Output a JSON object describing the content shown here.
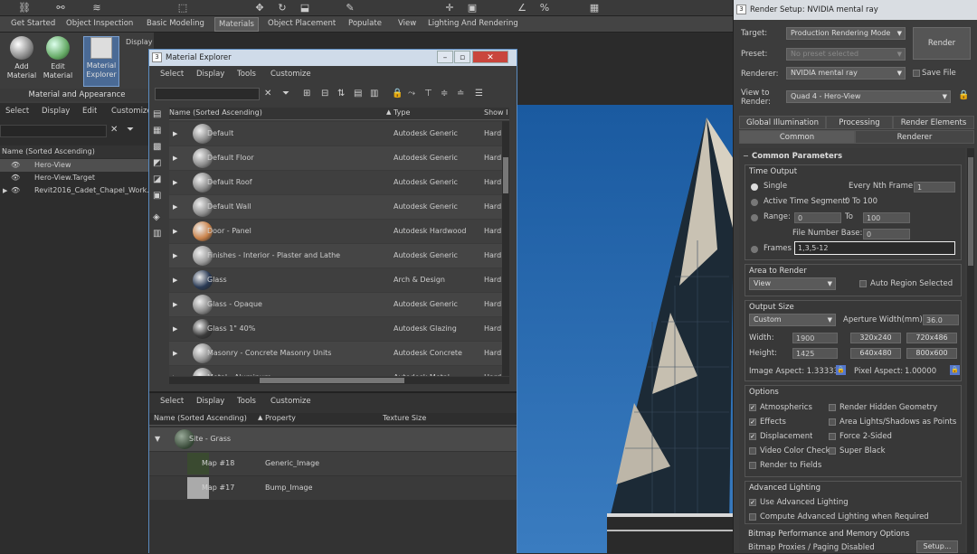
{
  "ribbon_tabs": [
    "Get Started",
    "Object Inspection",
    "Basic Modeling",
    "Materials",
    "Object Placement",
    "Populate",
    "View",
    "Lighting And Rendering"
  ],
  "ribbon": {
    "add_material": "Add Material",
    "edit_material": "Edit Material",
    "material_explorer": "Material Explorer",
    "display_maps": "Display Maps in View",
    "group_label": "Material and Appearance"
  },
  "scene": {
    "menu": [
      "Select",
      "Display",
      "Edit",
      "Customize"
    ],
    "column": "Name (Sorted Ascending)",
    "items": [
      "Hero-View",
      "Hero-View.Target",
      "Revit2016_Cadet_Chapel_Work..."
    ]
  },
  "material_explorer": {
    "title": "Material Explorer",
    "menu": [
      "Select",
      "Display",
      "Tools",
      "Customize"
    ],
    "columns": {
      "name": "Name (Sorted Ascending)",
      "type": "Type",
      "show": "Show In"
    },
    "rows": [
      {
        "name": "Default",
        "type": "Autodesk Generic",
        "show": "Hard",
        "color": "#8a8a8a"
      },
      {
        "name": "Default Floor",
        "type": "Autodesk Generic",
        "show": "Hard",
        "color": "#8c8c8c"
      },
      {
        "name": "Default Roof",
        "type": "Autodesk Generic",
        "show": "Hard",
        "color": "#8a8a8a"
      },
      {
        "name": "Default Wall",
        "type": "Autodesk Generic",
        "show": "Hard",
        "color": "#8e8e8e"
      },
      {
        "name": "Door - Panel",
        "type": "Autodesk Hardwood",
        "show": "Hard",
        "color": "#c9824a"
      },
      {
        "name": "Finishes - Interior - Plaster and Lathe",
        "type": "Autodesk Generic",
        "show": "Hard",
        "color": "#9a9a9a"
      },
      {
        "name": "Glass",
        "type": "Arch & Design",
        "show": "Hard",
        "color": "#2a3a55"
      },
      {
        "name": "Glass - Opaque",
        "type": "Autodesk Generic",
        "show": "Hard",
        "color": "#8a8a8a"
      },
      {
        "name": "Glass 1\" 40%",
        "type": "Autodesk Glazing",
        "show": "Hard",
        "color": "#3a3a3a"
      },
      {
        "name": "Masonry - Concrete Masonry Units",
        "type": "Autodesk Concrete",
        "show": "Hard",
        "color": "#8f8f8f"
      },
      {
        "name": "Metal - Aluminum",
        "type": "Autodesk Metal",
        "show": "Hard",
        "color": "#8a8a8a"
      }
    ],
    "lower_menu": [
      "Select",
      "Display",
      "Tools",
      "Customize"
    ],
    "lower_columns": {
      "name": "Name (Sorted Ascending)",
      "property": "Property",
      "texture": "Texture Size"
    },
    "lower_rows": [
      {
        "name": "Site - Grass",
        "property": ""
      },
      {
        "name": "Map #18",
        "property": "Generic_Image"
      },
      {
        "name": "Map #17",
        "property": "Bump_Image"
      }
    ]
  },
  "render_setup": {
    "title": "Render Setup: NVIDIA mental ray",
    "target_label": "Target:",
    "target": "Production Rendering Mode",
    "preset_label": "Preset:",
    "preset": "No preset selected",
    "renderer_label": "Renderer:",
    "renderer": "NVIDIA mental ray",
    "save_file": "Save File",
    "view_label": "View to Render:",
    "view": "Quad 4 - Hero-View",
    "render_button": "Render",
    "tabs_row1": [
      "Global Illumination",
      "Processing",
      "Render Elements"
    ],
    "tabs_row2": [
      "Common",
      "Renderer"
    ],
    "common_params": "Common Parameters",
    "time_output": "Time Output",
    "single": "Single",
    "every_nth": "Every Nth Frame:",
    "every_nth_val": "1",
    "active_segment": "Active Time Segment:",
    "active_range": "0 To 100",
    "range": "Range:",
    "range_from": "0",
    "range_to_label": "To",
    "range_to": "100",
    "file_number_base": "File Number Base:",
    "file_number_val": "0",
    "frames": "Frames",
    "frames_val": "1,3,5-12",
    "area_to_render": "Area to Render",
    "area": "View",
    "auto_region": "Auto Region Selected",
    "output_size": "Output Size",
    "output_preset": "Custom",
    "aperture": "Aperture Width(mm):",
    "aperture_val": "36.0",
    "width_label": "Width:",
    "width": "1900",
    "height_label": "Height:",
    "height": "1425",
    "sizes": [
      "320x240",
      "720x486",
      "640x480",
      "800x600"
    ],
    "image_aspect": "Image Aspect: 1.33333",
    "pixel_aspect": "Pixel Aspect:",
    "pixel_aspect_val": "1.00000",
    "options": "Options",
    "opt_left": [
      "Atmospherics",
      "Effects",
      "Displacement",
      "Video Color Check",
      "Render to Fields"
    ],
    "opt_left_checked": [
      true,
      true,
      true,
      false,
      false
    ],
    "opt_right": [
      "Render Hidden Geometry",
      "Area Lights/Shadows as Points",
      "Force 2-Sided",
      "Super Black"
    ],
    "advanced_lighting": "Advanced Lighting",
    "use_adv": "Use Advanced Lighting",
    "compute_adv": "Compute Advanced Lighting when Required",
    "bitmap_perf": "Bitmap Performance and Memory Options",
    "bitmap_proxies": "Bitmap Proxies / Paging Disabled",
    "setup_button": "Setup..."
  }
}
